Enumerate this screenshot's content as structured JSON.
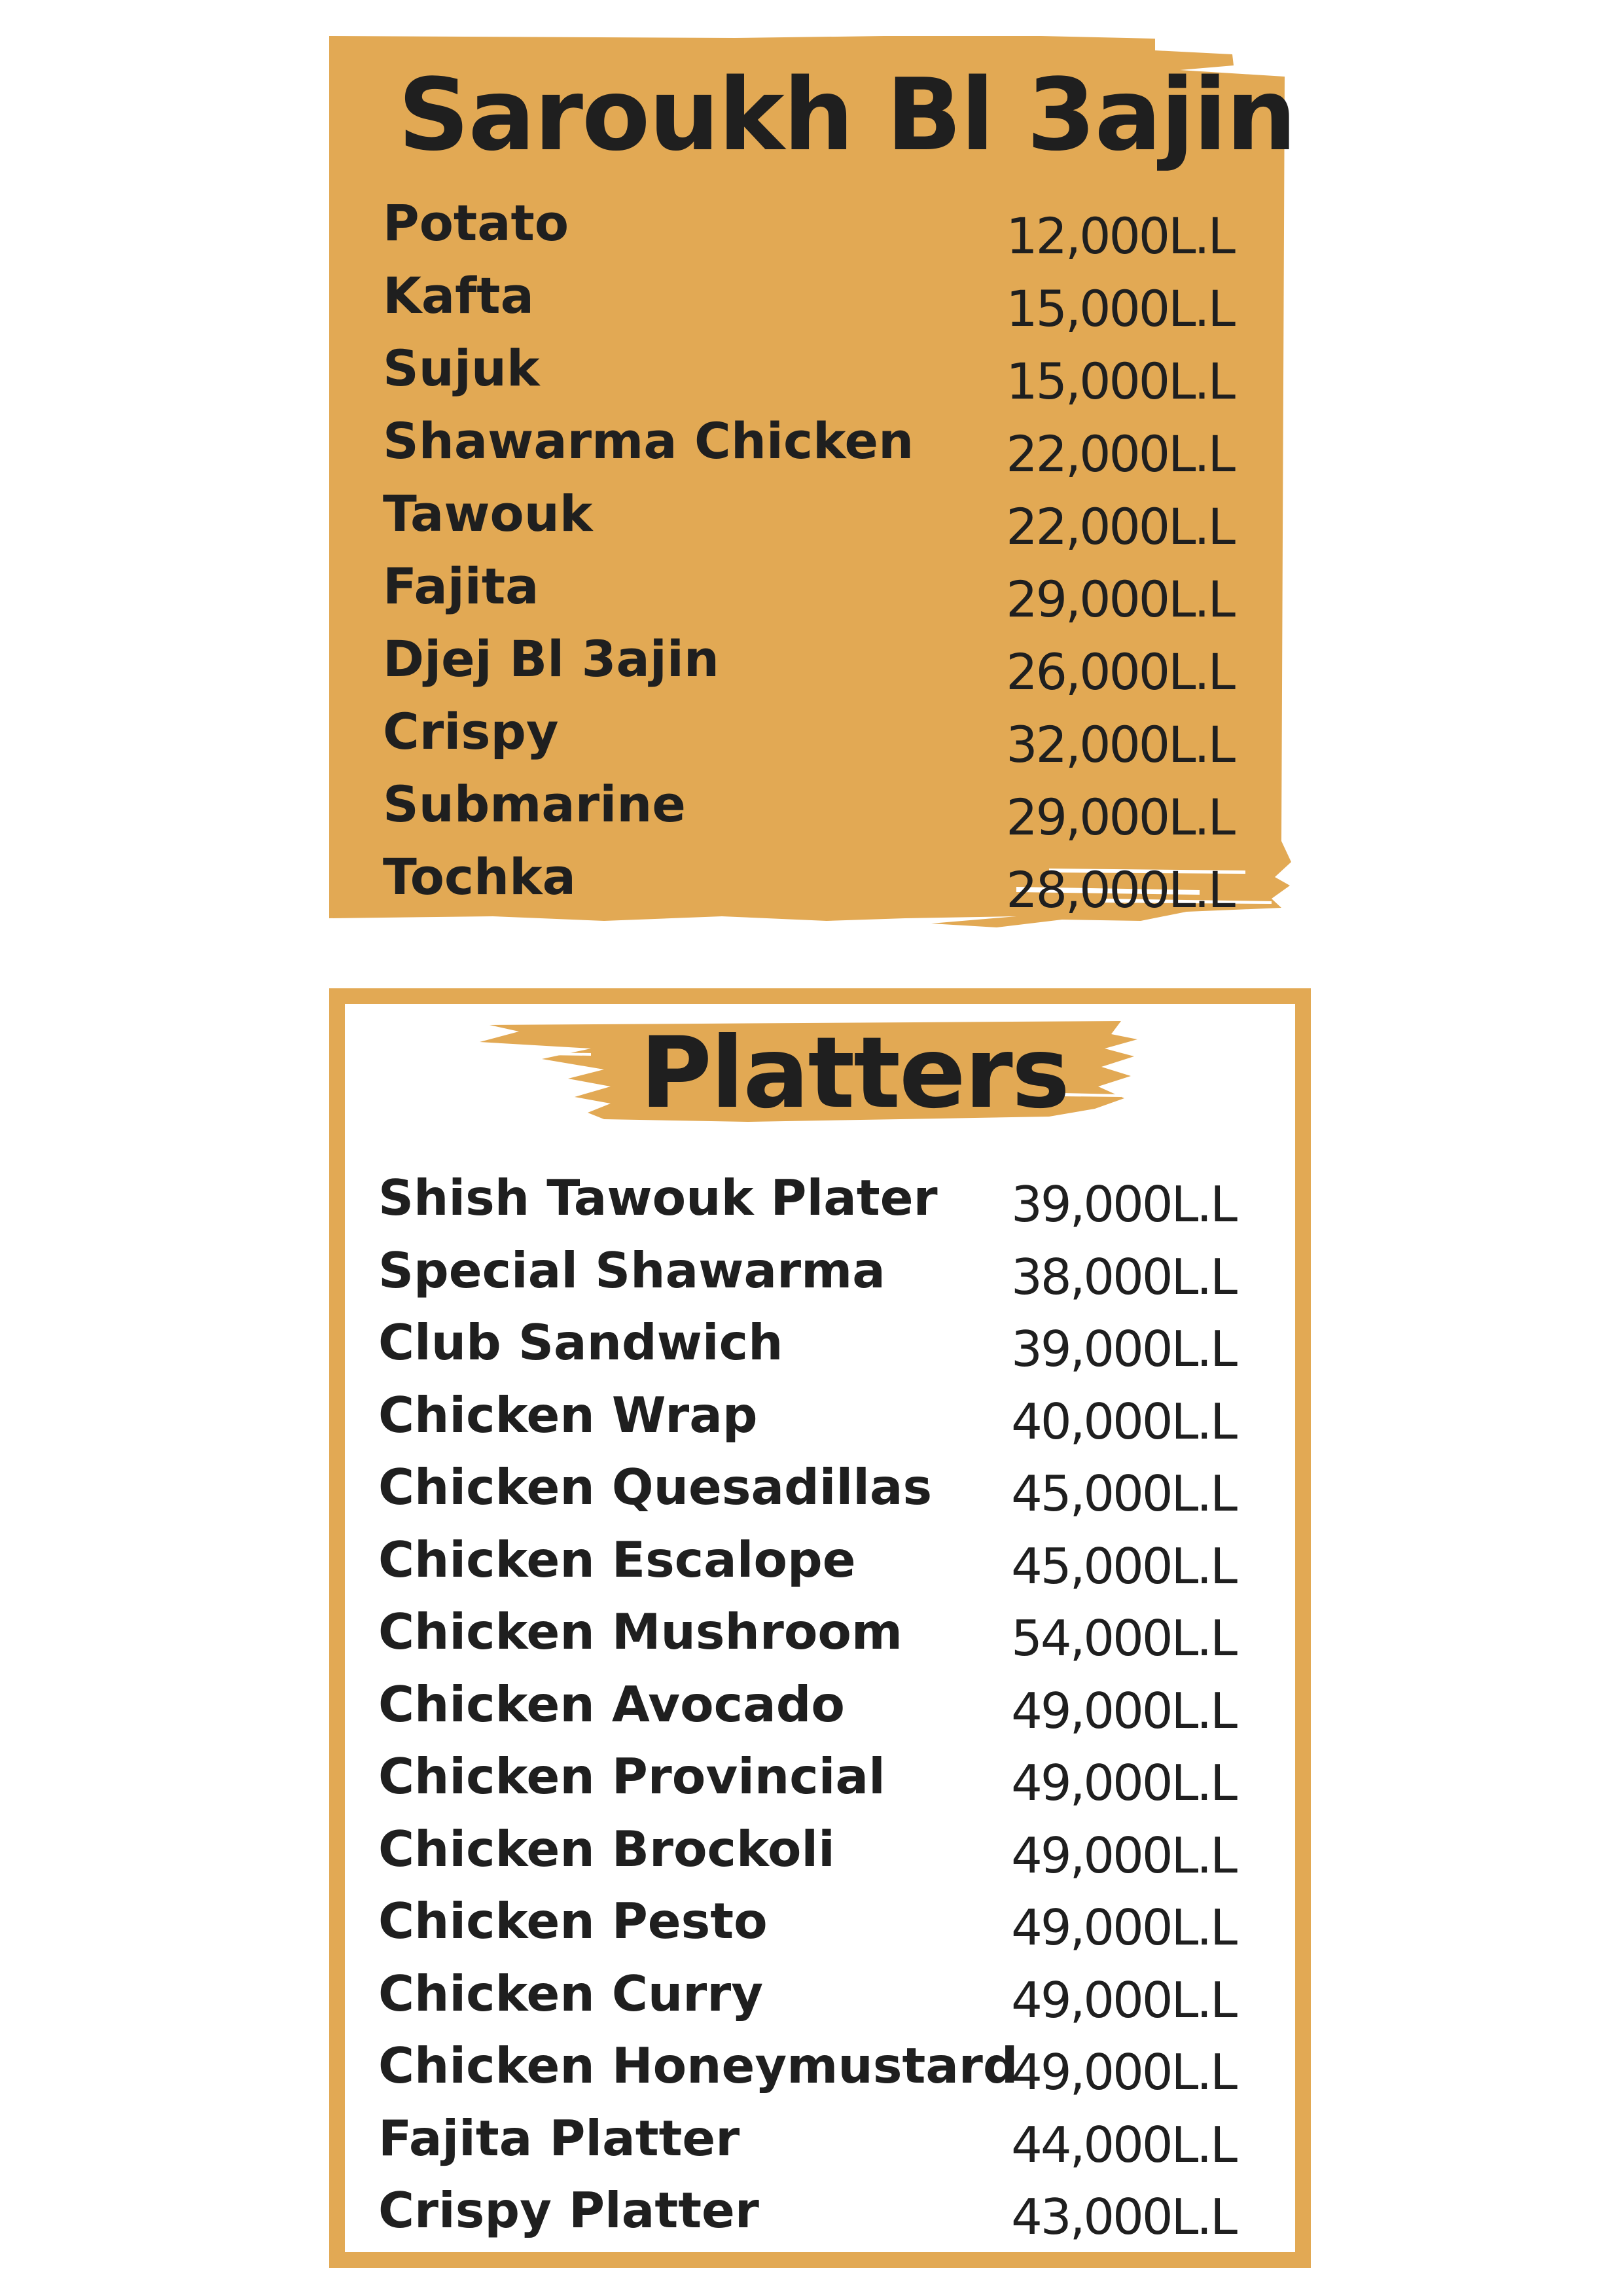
{
  "colors": {
    "accent": "#e2a954",
    "text": "#1f1f1f",
    "background": "#ffffff"
  },
  "sections": {
    "saroukh": {
      "title": "Saroukh Bl 3ajin",
      "items": [
        {
          "name": "Potato",
          "price": "12,000L.L"
        },
        {
          "name": "Kafta",
          "price": "15,000L.L"
        },
        {
          "name": "Sujuk",
          "price": "15,000L.L"
        },
        {
          "name": "Shawarma Chicken",
          "price": "22,000L.L"
        },
        {
          "name": "Tawouk",
          "price": "22,000L.L"
        },
        {
          "name": "Fajita",
          "price": "29,000L.L"
        },
        {
          "name": "Djej Bl 3ajin",
          "price": "26,000L.L"
        },
        {
          "name": "Crispy",
          "price": "32,000L.L"
        },
        {
          "name": "Submarine",
          "price": "29,000L.L"
        },
        {
          "name": "Tochka",
          "price": "28,000L.L"
        }
      ]
    },
    "platters": {
      "title": "Platters",
      "items": [
        {
          "name": "Shish Tawouk Plater",
          "price": "39,000L.L"
        },
        {
          "name": "Special Shawarma",
          "price": "38,000L.L"
        },
        {
          "name": "Club Sandwich",
          "price": "39,000L.L"
        },
        {
          "name": "Chicken Wrap",
          "price": "40,000L.L"
        },
        {
          "name": "Chicken Quesadillas",
          "price": "45,000L.L"
        },
        {
          "name": "Chicken Escalope",
          "price": "45,000L.L"
        },
        {
          "name": "Chicken Mushroom",
          "price": "54,000L.L"
        },
        {
          "name": "Chicken Avocado",
          "price": "49,000L.L"
        },
        {
          "name": "Chicken Provincial",
          "price": "49,000L.L"
        },
        {
          "name": "Chicken Brockoli",
          "price": "49,000L.L"
        },
        {
          "name": "Chicken Pesto",
          "price": "49,000L.L"
        },
        {
          "name": "Chicken Curry",
          "price": "49,000L.L"
        },
        {
          "name": "Chicken Honeymustard",
          "price": "49,000L.L"
        },
        {
          "name": "Fajita Platter",
          "price": "44,000L.L"
        },
        {
          "name": "Crispy Platter",
          "price": "43,000L.L"
        }
      ]
    }
  }
}
